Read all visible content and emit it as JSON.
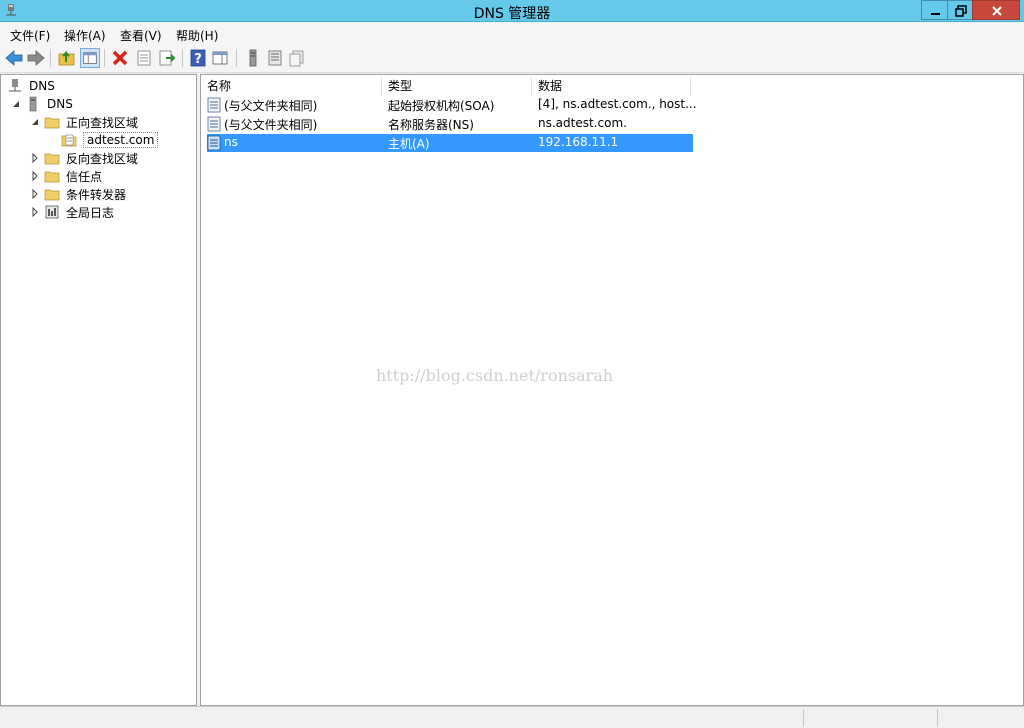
{
  "window": {
    "title": "DNS 管理器"
  },
  "menu": {
    "file": "文件(F)",
    "action": "操作(A)",
    "view": "查看(V)",
    "help": "帮助(H)"
  },
  "tree": {
    "root": "DNS",
    "server": "DNS",
    "forward_zones": "正向查找区域",
    "zone": "adtest.com",
    "reverse_zones": "反向查找区域",
    "trust_points": "信任点",
    "forwarders": "条件转发器",
    "global_logs": "全局日志"
  },
  "list": {
    "headers": {
      "name": "名称",
      "type": "类型",
      "data": "数据"
    },
    "rows": [
      {
        "name": "(与父文件夹相同)",
        "type": "起始授权机构(SOA)",
        "data": "[4], ns.adtest.com., host..."
      },
      {
        "name": "(与父文件夹相同)",
        "type": "名称服务器(NS)",
        "data": "ns.adtest.com."
      },
      {
        "name": "ns",
        "type": "主机(A)",
        "data": "192.168.11.1"
      }
    ]
  },
  "watermark": "http://blog.csdn.net/ronsarah"
}
